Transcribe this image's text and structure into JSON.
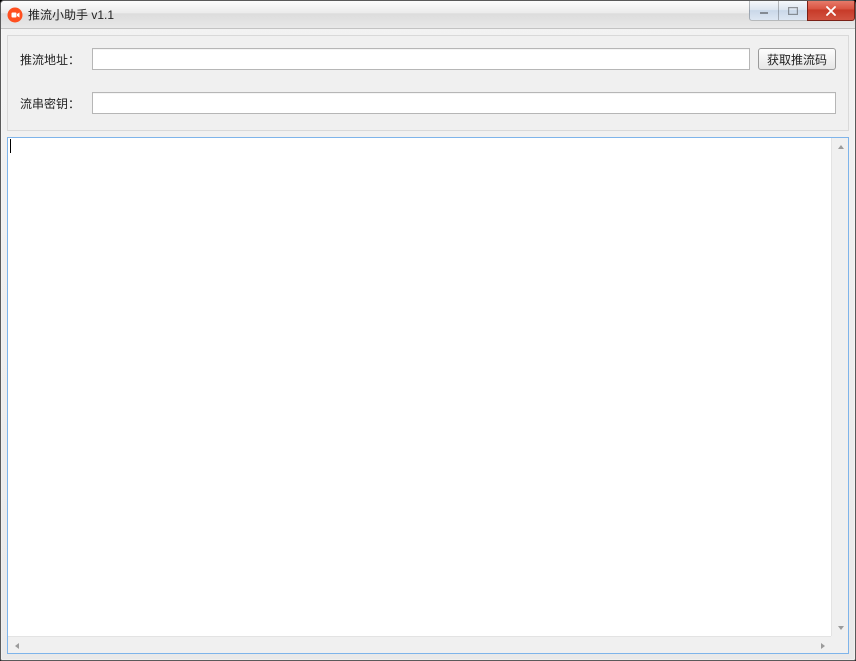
{
  "window": {
    "title": "推流小助手 v1.1"
  },
  "labels": {
    "push_url": "推流地址：",
    "stream_key": "流串密钥："
  },
  "buttons": {
    "get_code": "获取推流码"
  },
  "inputs": {
    "push_url_value": "",
    "stream_key_value": ""
  },
  "log": {
    "text": ""
  },
  "icons": {
    "app": "app-icon",
    "minimize": "minimize-icon",
    "maximize": "maximize-icon",
    "close": "close-icon"
  }
}
